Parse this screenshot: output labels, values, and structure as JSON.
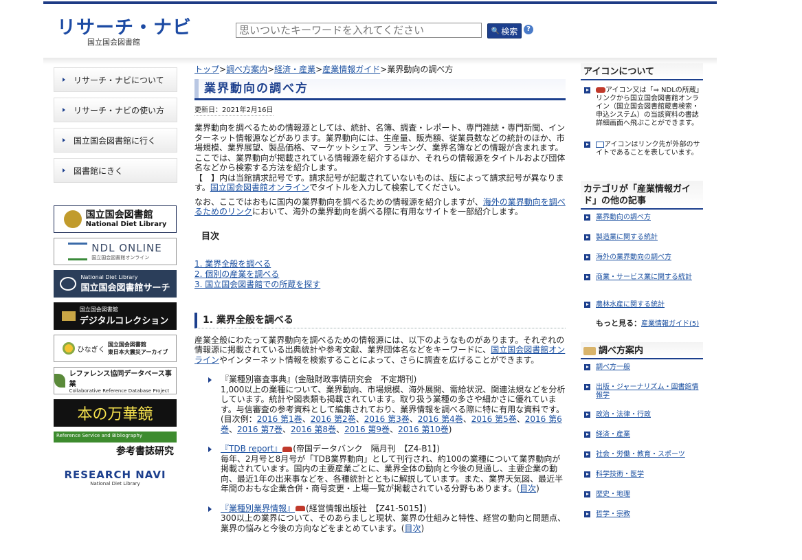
{
  "header": {
    "logo_title": "リサーチ・ナビ",
    "logo_sub": "国立国会図書館",
    "search_placeholder": "思いついたキーワードを入れてください",
    "search_button": "検索",
    "help_icon": "?"
  },
  "leftnav": [
    "リサーチ・ナビについて",
    "リサーチ・ナビの使い方",
    "国立国会図書館に行く",
    "図書館にきく"
  ],
  "banners": {
    "ndl_title": "国立国会図書館",
    "ndl_sub": "National Diet Library",
    "online_title": "NDL ONLINE",
    "online_sub": "国立国会図書館オンライン",
    "search_sub": "National Diet Library",
    "search_title": "国立国会図書館サーチ",
    "digital_sub": "国立国会図書館",
    "digital_title": "デジタルコレクション",
    "himawari_left": "ひなぎく",
    "himawari_r1": "国立国会図書館",
    "himawari_r2": "東日本大震災アーカイブ",
    "crd_title": "レファレンス協同データベース事業",
    "crd_sub": "Collaborative Reference Database Project",
    "kaleido": "本の万華鏡",
    "biblio_sub": "Reference Service and Bibliography",
    "biblio_title": "参考書誌研究",
    "rn_title": "RESEARCH NAVI",
    "rn_sub": "National Diet Library"
  },
  "breadcrumb": {
    "top": "トップ",
    "guide": "調べ方案内",
    "econ": "経済・産業",
    "industry": "産業情報ガイド",
    "current": "業界動向の調べ方",
    "sep": ">"
  },
  "main": {
    "title": "業界動向の調べ方",
    "updated": "更新日：2021年2月16日",
    "intro": "業界動向を調べるための情報源としては、統計、名簿、調査・レポート、専門雑誌・専門新聞、インターネット情報源などがあります。業界動向には、生産量、販売額、従業員数などの統計のほか、市場規模、業界展望、製品価格、マーケットシェア、ランキング、業界名簿などの情報が含まれます。ここでは、業界動向が掲載されている情報源を紹介するほか、それらの情報源をタイトルおよび団体名などから検索する方法を紹介します。",
    "note_pre": "【　】内は当館請求記号です。請求記号が記載されていないものは、版によって請求記号が異なります。",
    "note_link": "国立国会図書館オンライン",
    "note_post": "でタイトルを入力して検索してください。",
    "overseas_pre": "なお、ここではおもに国内の業界動向を調べるための情報源を紹介しますが、",
    "overseas_link": "海外の業界動向を調べるためのリンク",
    "overseas_post": "において、海外の業界動向を調べる際に有用なサイトを一部紹介します。",
    "toc_title": "目次",
    "toc": [
      "1. 業界全般を調べる",
      "2. 個別の産業を調べる",
      "3. 国立国会図書館での所蔵を探す"
    ],
    "section1_title": "1. 業界全般を調べる",
    "section1_pre": "産業全般にわたって業界動向を調べるための情報源には、以下のようなものがあります。それぞれの情報源に掲載されている出典統計や参考文献、業界団体名などをキーワードに、",
    "section1_link": "国立国会図書館オンライン",
    "section1_post": "やインターネット情報を検索することによって、さらに調査を広げることができます。",
    "entry1_title": "『業種別審査事典』(金融財政事情研究会　不定期刊)",
    "entry1_body": "1,000以上の業種について、業界動向、市場規模、海外展開、需給状況、関連法規などを分析しています。統計や図表類も掲載されています。取り扱う業種の多さや細かさに優れています。与信審査の参考資料として編集されており、業界情報を調べる際に特に有用な資料です。(目次例：",
    "entry1_links": [
      "2016 第1巻",
      "2016 第2巻",
      "2016 第3巻",
      "2016 第4巻",
      "2016 第5巻",
      "2016 第6巻",
      "2016 第7巻",
      "2016 第8巻",
      "2016 第9巻",
      "2016 第10巻"
    ],
    "entry1_end": ")",
    "entry2_link": "『TDB report』",
    "entry2_meta": "(帝国データバンク　隔月刊　【Z4-B1】)",
    "entry2_body": "毎年、2月号と8月号が「TDB業界動向」として刊行され、約100の業種について業界動向が掲載されています。国内の主要産業ごとに、業界全体の動向と今後の見通し、主要企業の動向、最近1年の出来事などを、各種統計とともに解説しています。また、業界天気図、最近半年間のおもな企業合併・商号変更・上場一覧が掲載されている分野もあります。(",
    "entry2_toc": "目次",
    "entry2_end": ")",
    "entry3_link": "『業種別業界情報』",
    "entry3_meta": "(経営情報出版社　【Z41-5015】)",
    "entry3_body": "300以上の業界について、そのあらましと現状、業界の仕組みと特性、経営の動向と問題点、業界の悩みと今後の方向などをまとめています。(",
    "entry3_toc": "目次",
    "entry3_end": ")"
  },
  "right": {
    "icons_title": "アイコンについて",
    "icon1_text": "アイコン又は「⇒ NDLの所蔵」リンクから国立国会図書館オンライン（国立国会図書館蔵書検索・申込システム）の当該資料の書誌詳細画面へ飛ぶことができます。",
    "icon2_text": "アイコンはリンク先が外部のサイトであることを表しています。",
    "category_title": "カテゴリが「産業情報ガイド」の他の記事",
    "category_items": [
      "業界動向の調べ方",
      "製造業に関する統計",
      "海外の業界動向の調べ方",
      "商業・サービス業に関する統計",
      "農林水産に関する統計"
    ],
    "more_label": "もっと見る：",
    "more_link": "産業情報ガイド(5)",
    "guide_title": "調べ方案内",
    "guide_items": [
      "調べ方一般",
      "出版・ジャーナリズム・図書館情報学",
      "政治・法律・行政",
      "経済・産業",
      "社会・労働・教育・スポーツ",
      "科学技術・医学",
      "歴史・地理",
      "哲学・宗教"
    ]
  }
}
